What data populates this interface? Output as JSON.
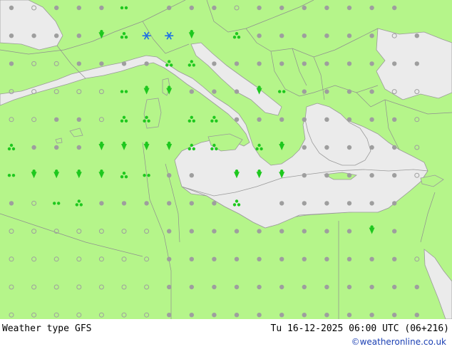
{
  "footer": {
    "title": "Weather type",
    "model": "GFS",
    "valid_time": "Tu 16-12-2025 06:00 UTC (06+216)",
    "credit": "©weatheronline.co.uk"
  },
  "colors": {
    "land": "#b5f58a",
    "sea": "#ebebeb",
    "border": "#8f8f8f",
    "coast": "#9a9a9a",
    "no_precip_symbol": "#9e9e9e",
    "rain_symbol": "#1ec81e",
    "snow_symbol": "#1e6ee6"
  },
  "map": {
    "symbol_legend": {
      "dot": "cloudy / no precipitation",
      "ring": "clear",
      "drizzle": "drizzle",
      "rain": "rain",
      "showers": "showers",
      "snow": "snow"
    }
  }
}
